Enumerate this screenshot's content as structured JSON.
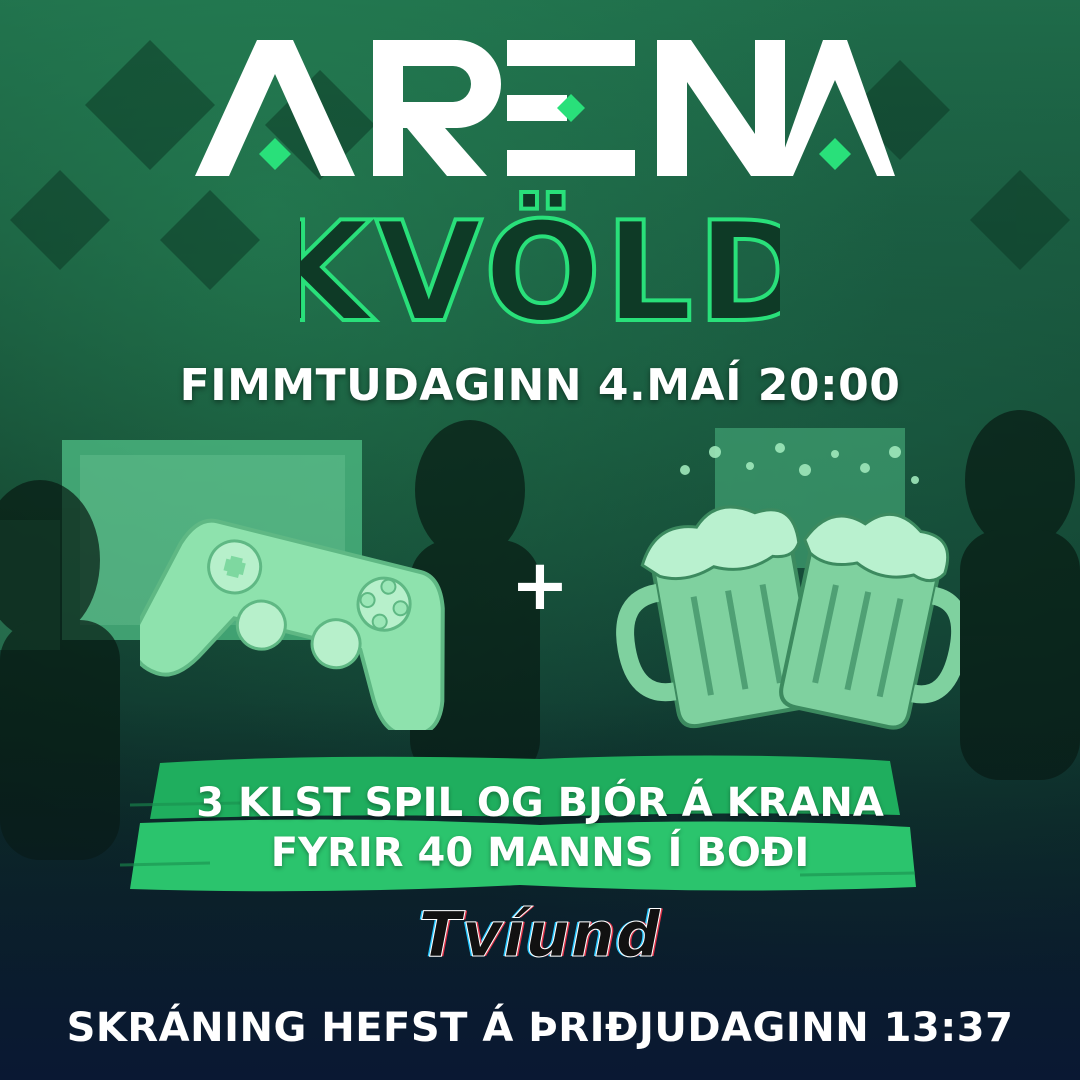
{
  "logo": {
    "text": "ARENA"
  },
  "headline": "KVÖLD",
  "event": {
    "date_line": "FIMMTUDAGINN 4.MAÍ 20:00"
  },
  "icons": {
    "left": "gamepad-icon",
    "middle": "plus-icon",
    "right": "beer-mugs-icon"
  },
  "plus_symbol": "+",
  "offer": {
    "line1": "3 KLST SPIL OG BJÓR Á KRANA",
    "line2": "FYRIR 40 MANNS Í BOÐI"
  },
  "sponsor": "Tvíund",
  "registration": "SKRÁNING HEFST Á ÞRIÐJUDAGINN 13:37",
  "colors": {
    "accent_green": "#29e07a",
    "light_green": "#8fe6ad",
    "text": "#ffffff"
  }
}
